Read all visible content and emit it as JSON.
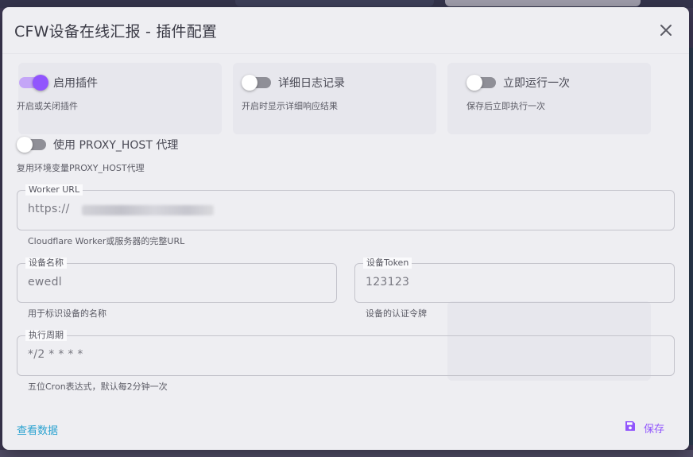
{
  "dialog": {
    "title": "CFW设备在线汇报 - 插件配置"
  },
  "switches": {
    "enable": {
      "label": "启用插件",
      "hint": "开启或关闭插件",
      "on": true
    },
    "verbose": {
      "label": "详细日志记录",
      "hint": "开启时显示详细响应结果",
      "on": false
    },
    "run_once": {
      "label": "立即运行一次",
      "hint": "保存后立即执行一次",
      "on": false
    },
    "proxy": {
      "label": "使用 PROXY_HOST 代理",
      "hint": "复用环境变量PROXY_HOST代理",
      "on": false
    }
  },
  "fields": {
    "worker_url": {
      "label": "Worker URL",
      "value": "https://",
      "hint": "Cloudflare Worker或服务器的完整URL"
    },
    "device_name": {
      "label": "设备名称",
      "value": "ewedl",
      "hint": "用于标识设备的名称"
    },
    "device_token": {
      "label": "设备Token",
      "value": "123123",
      "hint": "设备的认证令牌"
    },
    "cron": {
      "label": "执行周期",
      "value": "*/2 * * * *",
      "hint": "五位Cron表达式，默认每2分钟一次"
    }
  },
  "footer": {
    "view_data": "查看数据",
    "save": "保存"
  },
  "colors": {
    "accent": "#9155fd",
    "link": "#2aa2d0"
  }
}
